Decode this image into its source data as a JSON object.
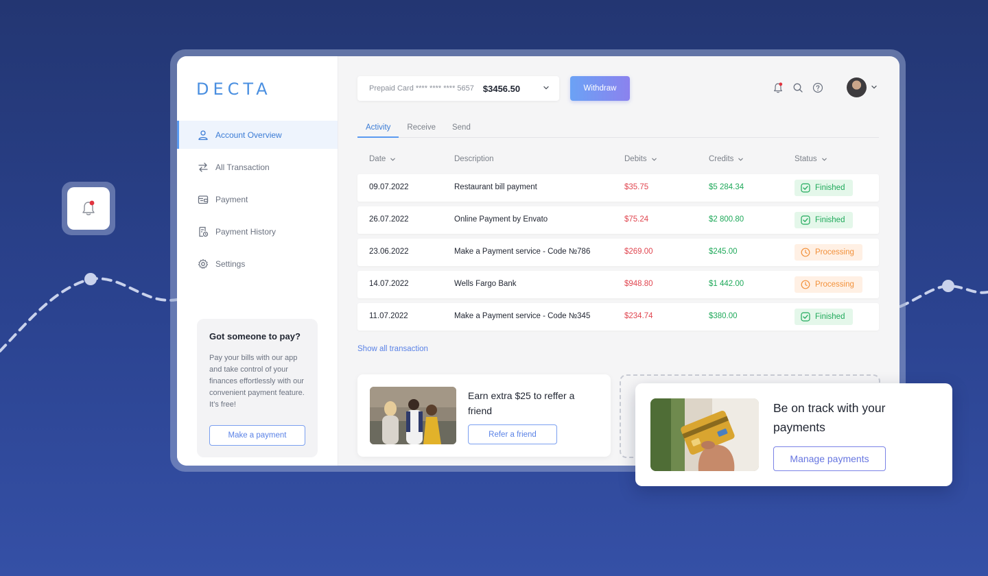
{
  "brand": {
    "logo_text": "DECTA",
    "accent": "#5a9af0"
  },
  "sidebar": {
    "items": [
      {
        "label": "Account Overview",
        "icon": "user-icon",
        "active": true
      },
      {
        "label": "All Transaction",
        "icon": "transfer-arrows-icon",
        "active": false
      },
      {
        "label": "Payment",
        "icon": "wallet-icon",
        "active": false
      },
      {
        "label": "Payment History",
        "icon": "history-icon",
        "active": false
      },
      {
        "label": "Settings",
        "icon": "gear-icon",
        "active": false
      }
    ],
    "promo": {
      "title": "Got someone to pay?",
      "text": "Pay your bills with our app and take control of your finances effortlessly with our convenient payment feature. It’s free!",
      "button": "Make a payment"
    }
  },
  "header": {
    "card_label": "Prepaid Card **** **** **** 5657",
    "balance": "$3456.50",
    "withdraw_label": "Withdraw"
  },
  "tabs": [
    {
      "label": "Activity",
      "active": true
    },
    {
      "label": "Receive",
      "active": false
    },
    {
      "label": "Send",
      "active": false
    }
  ],
  "table": {
    "columns": [
      "Date",
      "Description",
      "Debits",
      "Credits",
      "Status"
    ],
    "rows": [
      {
        "date": "09.07.2022",
        "description": "Restaurant bill payment",
        "debit": "$35.75",
        "credit": "$5 284.34",
        "status": "Finished"
      },
      {
        "date": "26.07.2022",
        "description": "Online Payment by Envato",
        "debit": "$75.24",
        "credit": "$2 800.80",
        "status": "Finished"
      },
      {
        "date": "23.06.2022",
        "description": "Make a Payment service - Code №786",
        "debit": "$269.00",
        "credit": "$245.00",
        "status": "Processing"
      },
      {
        "date": "14.07.2022",
        "description": "Wells Fargo Bank",
        "debit": "$948.80",
        "credit": "$1 442.00",
        "status": "Processing"
      },
      {
        "date": "11.07.2022",
        "description": "Make a Payment service - Code №345",
        "debit": "$234.74",
        "credit": "$380.00",
        "status": "Finished"
      }
    ],
    "show_all": "Show all transaction"
  },
  "refer": {
    "title": "Earn extra $25 to reffer a friend",
    "button": "Refer a friend"
  },
  "float_card": {
    "title": "Be on track with your payments",
    "button": "Manage payments"
  },
  "colors": {
    "debit": "#e0454f",
    "credit": "#1fa95a",
    "finished": "#1fa95a",
    "processing": "#f2913b"
  }
}
